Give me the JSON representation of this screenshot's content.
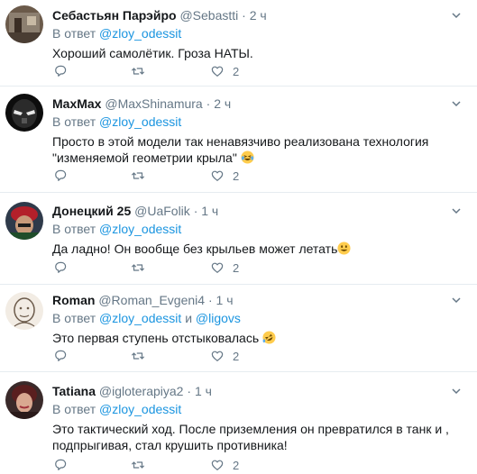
{
  "tweets": [
    {
      "name": "Себастьян Парэйро",
      "handle": "@Sebastti",
      "dot": "·",
      "time": "2 ч",
      "reply_prefix": "В ответ",
      "mentions": [
        "@zloy_odessit"
      ],
      "text": "Хороший самолётик. Гроза НАТЫ.",
      "likes": "2"
    },
    {
      "name": "MaxMax",
      "handle": "@MaxShinamura",
      "dot": "·",
      "time": "2 ч",
      "reply_prefix": "В ответ",
      "mentions": [
        "@zloy_odessit"
      ],
      "text": "Просто в этой модели так ненавязчиво реализована технология \"изменяемой геометрии крыла\"",
      "emoji": "laughing-tears",
      "likes": "2"
    },
    {
      "name": "Донецкий 25",
      "handle": "@UaFolik",
      "dot": "·",
      "time": "1 ч",
      "reply_prefix": "В ответ",
      "mentions": [
        "@zloy_odessit"
      ],
      "text": "Да ладно! Он вообще без крыльев может летать",
      "emoji": "smile",
      "likes": "2"
    },
    {
      "name": "Roman",
      "handle": "@Roman_Evgeni4",
      "dot": "·",
      "time": "1 ч",
      "reply_prefix": "В ответ",
      "mentions": [
        "@zloy_odessit",
        "@ligovs"
      ],
      "mention_joiner": "и",
      "text": "Это первая ступень отстыковалась",
      "emoji": "rofl",
      "likes": "2"
    },
    {
      "name": "Tatiana",
      "handle": "@igloterapiya2",
      "dot": "·",
      "time": "1 ч",
      "reply_prefix": "В ответ",
      "mentions": [
        "@zloy_odessit"
      ],
      "text": "Это тактический ход. После приземления он превратился в танк и , подпрыгивая, стал крушить противника!",
      "likes": "2"
    }
  ],
  "colors": {
    "text": "#14171a",
    "secondary": "#657786",
    "link": "#1b95e0",
    "divider": "#e6ecf0",
    "emoji": "#ffcc4d"
  },
  "icons": [
    "reply-icon",
    "retweet-icon",
    "like-icon",
    "caret-down-icon"
  ]
}
